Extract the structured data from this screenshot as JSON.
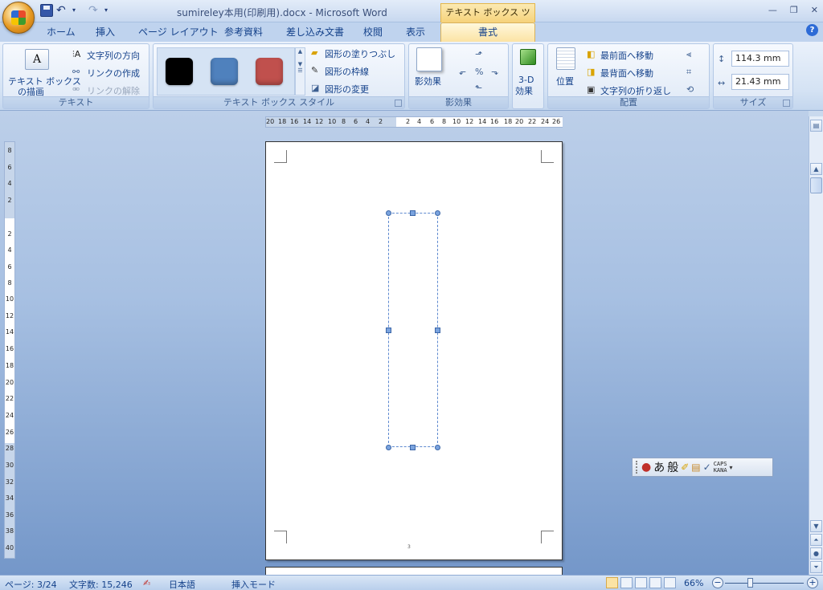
{
  "title_bar": {
    "document_title": "sumireley本用(印刷用).docx - Microsoft Word",
    "context_tools_label": "テキスト ボックス ツール"
  },
  "tabs": [
    "ホーム",
    "挿入",
    "ページ レイアウト",
    "参考資料",
    "差し込み文書",
    "校閲",
    "表示"
  ],
  "active_tab": "書式",
  "ribbon": {
    "text_group": {
      "draw_textbox": [
        "テキスト ボックス",
        "の描画"
      ],
      "text_direction": "文字列の方向",
      "create_link": "リンクの作成",
      "break_link": "リンクの解除",
      "label": "テキスト"
    },
    "style_group": {
      "swatch_colors": [
        "#000000",
        "#4f81bd",
        "#c0504d"
      ],
      "shape_fill": "図形の塗りつぶし",
      "shape_outline": "図形の枠線",
      "change_shape": "図形の変更",
      "label": "テキスト ボックス スタイル"
    },
    "shadow_group": {
      "shadow_effects": "影効果",
      "label": "影効果"
    },
    "threed_group": {
      "effects": [
        "3-D",
        "効果"
      ]
    },
    "arrange_group": {
      "position": "位置",
      "bring_front": "最前面へ移動",
      "send_back": "最背面へ移動",
      "text_wrap": "文字列の折り返し",
      "label": "配置"
    },
    "size_group": {
      "height": "114.3 mm",
      "width": "21.43 mm",
      "label": "サイズ"
    }
  },
  "ruler": {
    "horizontal_labels": [
      "20",
      "18",
      "16",
      "14",
      "12",
      "10",
      "8",
      "6",
      "4",
      "2",
      "2",
      "4",
      "6",
      "8",
      "10",
      "12",
      "14",
      "16",
      "18",
      "20",
      "22",
      "24",
      "26"
    ],
    "vertical_labels": [
      "8",
      "6",
      "4",
      "2",
      "2",
      "4",
      "6",
      "8",
      "10",
      "12",
      "14",
      "16",
      "18",
      "20",
      "22",
      "24",
      "26",
      "28",
      "30",
      "32",
      "34",
      "36",
      "38",
      "40"
    ]
  },
  "page": {
    "footer_mark": "3"
  },
  "language_bar": {
    "ime_mode": "あ",
    "conversion": "般",
    "caps": "CAPS",
    "kana": "KANA"
  },
  "status_bar": {
    "page": "ページ: 3/24",
    "word_count": "文字数: 15,246",
    "language": "日本語",
    "mode": "挿入モード",
    "zoom": "66%"
  }
}
